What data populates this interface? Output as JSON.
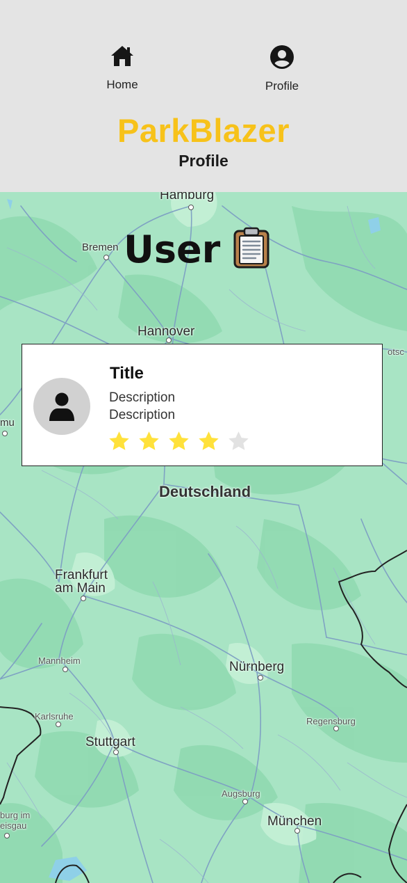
{
  "nav": {
    "items": [
      {
        "label": "Home",
        "icon": "home-icon"
      },
      {
        "label": "Profile",
        "icon": "user-circle-icon"
      }
    ]
  },
  "header": {
    "app_title": "ParkBlazer",
    "page_subtitle": "Profile",
    "accent_color": "#f7c21a"
  },
  "map": {
    "cities": {
      "hamburg": "Hamburg",
      "bremen": "Bremen",
      "hannover": "Hannover",
      "deutschland": "Deutschland",
      "frankfurt_1": "Frankfurt",
      "frankfurt_2": "am Main",
      "mannheim": "Mannheim",
      "karlsruhe": "Karlsruhe",
      "stuttgart": "Stuttgart",
      "nurnberg": "Nürnberg",
      "regensburg": "Regensburg",
      "augsburg": "Augsburg",
      "munchen": "München",
      "freiburg_1": "burg im",
      "freiburg_2": "eisgau",
      "left_edge": "mu",
      "right_edge": "otsc"
    }
  },
  "profile": {
    "heading": "User",
    "heading_icon": "clipboard-icon"
  },
  "card": {
    "avatar_icon": "person-icon",
    "title": "Title",
    "description_1": "Description",
    "description_2": "Description",
    "rating": 4,
    "rating_max": 5,
    "star_color": "#ffe13b",
    "star_empty_color": "#e2e2e2"
  }
}
